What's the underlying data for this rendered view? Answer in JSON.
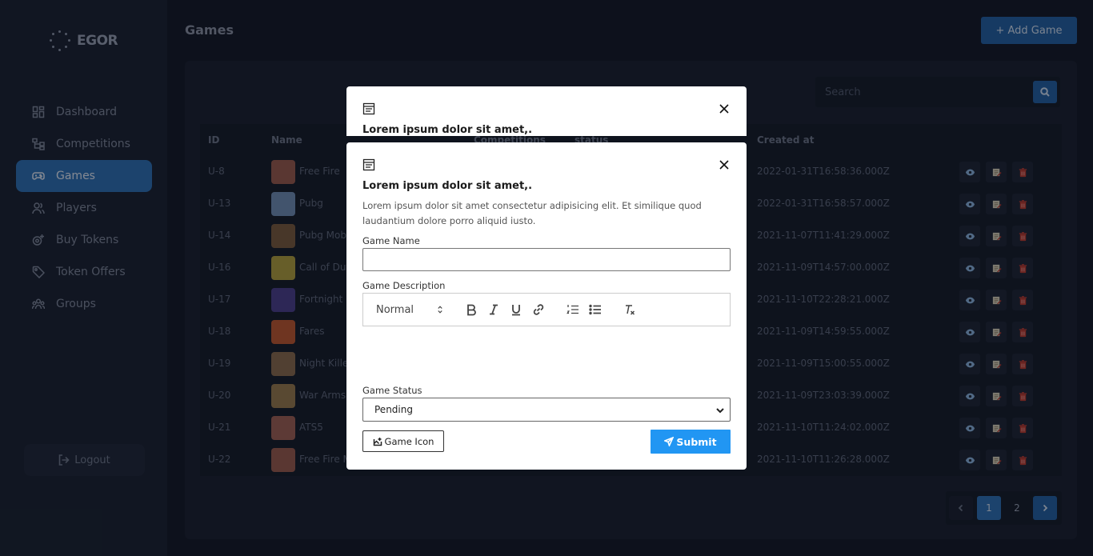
{
  "app": {
    "logo_text": "EGOR"
  },
  "sidebar": {
    "items": [
      {
        "label": "Dashboard",
        "icon": "dashboard-icon",
        "active": false
      },
      {
        "label": "Competitions",
        "icon": "competitions-icon",
        "active": false
      },
      {
        "label": "Games",
        "icon": "gamepad-icon",
        "active": true
      },
      {
        "label": "Players",
        "icon": "players-icon",
        "active": false
      },
      {
        "label": "Buy Tokens",
        "icon": "tokens-icon",
        "active": false
      },
      {
        "label": "Token Offers",
        "icon": "tag-icon",
        "active": false
      },
      {
        "label": "Groups",
        "icon": "groups-icon",
        "active": false
      }
    ],
    "logout_label": "Logout"
  },
  "header": {
    "title": "Games",
    "add_button_label": "+ Add Game"
  },
  "search": {
    "placeholder": "Search"
  },
  "table": {
    "columns": [
      "ID",
      "Name",
      "Competitions",
      "status",
      "Created at"
    ],
    "rows": [
      {
        "id": "U-8",
        "name": "Free Fire",
        "created": "2022-01-31T16:58:36.000Z",
        "thumb": "#9b5a4a"
      },
      {
        "id": "U-13",
        "name": "Pubg",
        "created": "2022-01-31T16:58:57.000Z",
        "thumb": "#6f8fb5"
      },
      {
        "id": "U-14",
        "name": "Pubg Mobile",
        "created": "2021-11-07T11:41:29.000Z",
        "thumb": "#7a5a3a"
      },
      {
        "id": "U-16",
        "name": "Call of Duty",
        "created": "2021-11-09T14:57:00.000Z",
        "thumb": "#b3a03a"
      },
      {
        "id": "U-17",
        "name": "Fortnight",
        "created": "2021-11-10T22:28:21.000Z",
        "thumb": "#4a3d8a"
      },
      {
        "id": "U-18",
        "name": "Fares",
        "created": "2021-11-09T14:59:55.000Z",
        "thumb": "#c2562a"
      },
      {
        "id": "U-19",
        "name": "Night Killer",
        "created": "2021-11-09T15:00:55.000Z",
        "thumb": "#8a6a4a"
      },
      {
        "id": "U-20",
        "name": "War Arms",
        "created": "2021-11-09T23:03:39.000Z",
        "thumb": "#9a7a4a"
      },
      {
        "id": "U-21",
        "name": "ATS5",
        "created": "2021-11-10T11:24:02.000Z",
        "thumb": "#a06050"
      },
      {
        "id": "U-22",
        "name": "Free Fire M",
        "created": "2021-11-10T11:26:28.000Z",
        "thumb": "#9b5a4a"
      }
    ]
  },
  "pagination": {
    "pages": [
      "1",
      "2"
    ],
    "current": "1"
  },
  "modal_back": {
    "title": "Lorem ipsum dolor sit amet,."
  },
  "modal": {
    "title": "Lorem ipsum dolor sit amet,.",
    "description": "Lorem ipsum dolor sit amet consectetur adipisicing elit. Et similique quod laudantium dolore porro aliquid iusto.",
    "game_name_label": "Game Name",
    "game_name_value": "",
    "game_description_label": "Game Description",
    "editor_format": "Normal",
    "game_status_label": "Game Status",
    "game_status_value": "Pending",
    "game_icon_label": "Game Icon",
    "submit_label": "Submit"
  },
  "colors": {
    "accent": "#1f5fa3",
    "submit": "#2196f3",
    "active_nav": "#2a6fb5",
    "delete": "#c0392b"
  }
}
